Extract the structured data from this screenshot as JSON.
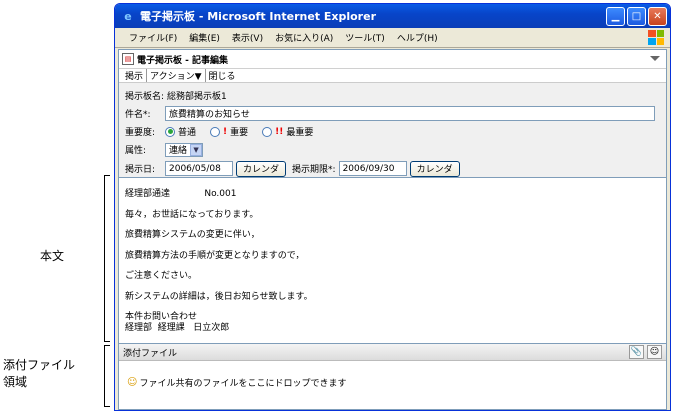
{
  "annotations": {
    "body_label": "本文",
    "attach_label_line1": "添付ファイル",
    "attach_label_line2": "領域"
  },
  "window": {
    "title": "電子掲示板 - Microsoft Internet Explorer",
    "menu": [
      "ファイル(F)",
      "編集(E)",
      "表示(V)",
      "お気に入り(A)",
      "ツール(T)",
      "ヘルプ(H)"
    ]
  },
  "app": {
    "title": "電子掲示板 - 記事編集",
    "actions": [
      "掲示",
      "アクション▼",
      "閉じる"
    ]
  },
  "form": {
    "board_label": "掲示板名:",
    "board_value": "総務部掲示板1",
    "subject_label": "件名",
    "required_mark": "*:",
    "subject_value": "旅費精算のお知らせ",
    "importance_label": "重要度:",
    "importance_options": [
      "普通",
      "重要",
      "最重要"
    ],
    "importance_marks": [
      "!",
      "!!"
    ],
    "attribute_label": "属性:",
    "attribute_value": "連絡",
    "post_date_label": "掲示日:",
    "post_date_value": "2006/05/08",
    "calendar_label": "カレンダ",
    "deadline_label": "掲示期限",
    "deadline_value": "2006/09/30"
  },
  "body": {
    "lines": [
      "経理部通達            No.001",
      "毎々，お世話になっております。",
      "旅費精算システムの変更に伴い，",
      "旅費精算方法の手順が変更となりますので，",
      "ご注意ください。",
      "新システムの詳細は，後日お知らせ致します。"
    ],
    "contact_line1": "本件お問い合わせ",
    "contact_line2": "経理部  経理課   日立次郎"
  },
  "attachments": {
    "header": "添付ファイル",
    "drop_text": "ファイル共有のファイルをここにドロップできます"
  }
}
